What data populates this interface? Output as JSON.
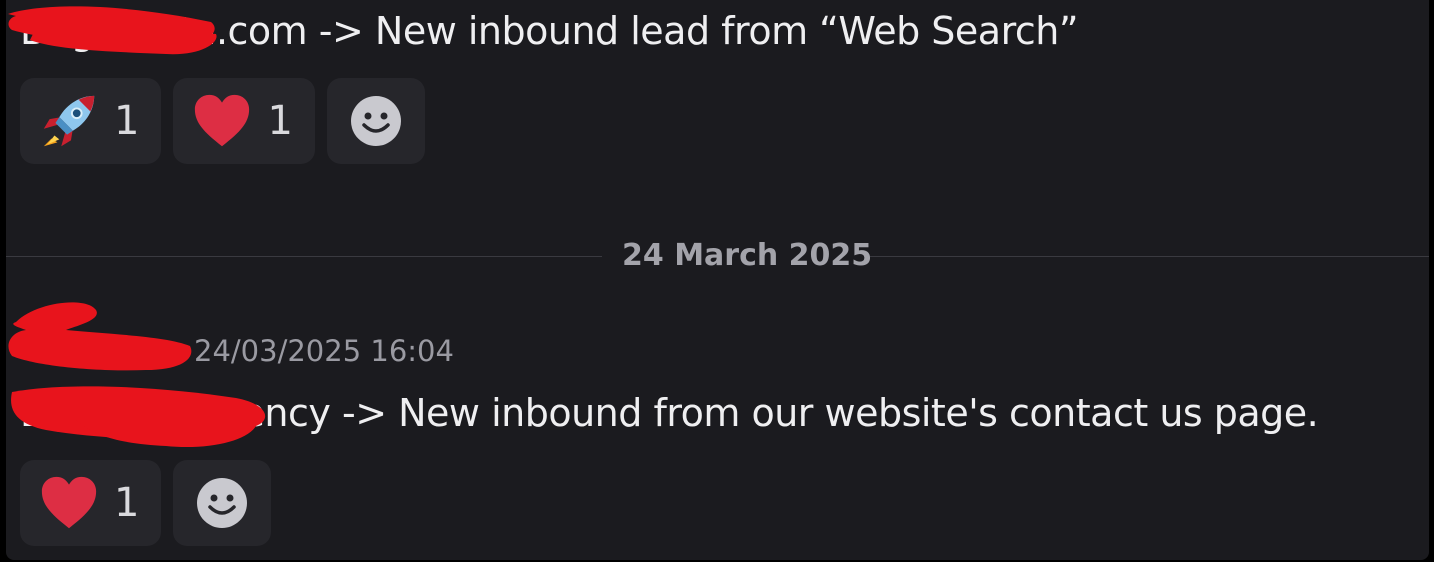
{
  "messages": [
    {
      "text": "Brightdata.com -> New inbound lead from “Web Search”",
      "reactions": [
        {
          "emoji": "rocket-emoji",
          "count": "1"
        },
        {
          "emoji": "red-heart-emoji",
          "count": "1"
        }
      ],
      "add_reaction_icon": "smiley-icon"
    },
    {
      "author": "",
      "timestamp": "24/03/2025 16:04",
      "text": "Business agency -> New inbound from our website's contact us page.",
      "reactions": [
        {
          "emoji": "red-heart-emoji",
          "count": "1"
        }
      ],
      "add_reaction_icon": "smiley-icon"
    }
  ],
  "date_divider": "24 March 2025",
  "colors": {
    "background": "#1b1b1f",
    "reaction_bg": "#26262b",
    "text": "#efeff1",
    "muted": "#9a9aa2",
    "redaction": "#e8141c"
  }
}
